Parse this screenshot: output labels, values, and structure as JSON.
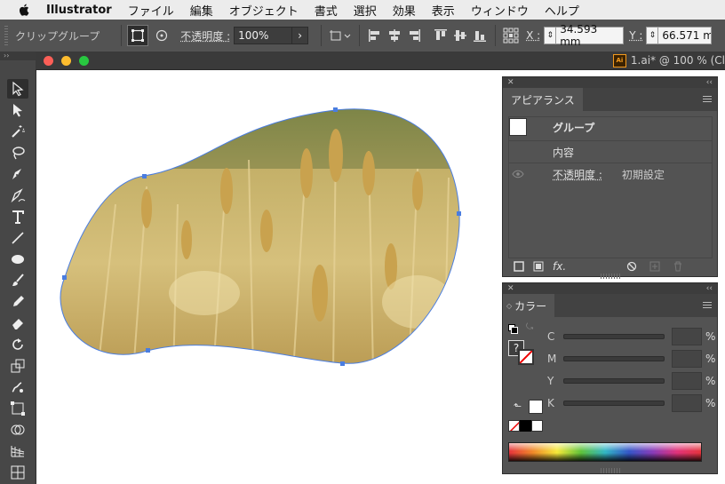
{
  "menubar": {
    "app_name": "Illustrator",
    "items": [
      "ファイル",
      "編集",
      "オブジェクト",
      "書式",
      "選択",
      "効果",
      "表示",
      "ウィンドウ",
      "ヘルプ"
    ]
  },
  "control_bar": {
    "selection_label": "クリップグループ",
    "opacity_label": "不透明度 :",
    "opacity_value": "100%",
    "x_label": "X :",
    "x_value": "34.593 mm",
    "y_label": "Y :",
    "y_value": "66.571 m"
  },
  "document": {
    "title": "1.ai* @ 100 % (Cl"
  },
  "appearance_panel": {
    "tab": "アピアランス",
    "group_label": "グループ",
    "contents_label": "内容",
    "opacity_label": "不透明度 :",
    "opacity_value": "初期設定",
    "fx_label": "fx."
  },
  "color_panel": {
    "tab": "カラー",
    "channels": [
      "C",
      "M",
      "Y",
      "K"
    ],
    "percent": "%",
    "unknown_mark": "?"
  },
  "colors": {
    "selection_blue": "#4a7de0",
    "ui_dark": "#535353",
    "canvas": "#ffffff"
  },
  "icons": {
    "toolbar": [
      "selection-tool-icon",
      "direct-selection-tool-icon",
      "magic-wand-tool-icon",
      "lasso-tool-icon",
      "pen-tool-icon",
      "curvature-tool-icon",
      "type-tool-icon",
      "line-tool-icon",
      "ellipse-tool-icon",
      "paintbrush-tool-icon",
      "pencil-tool-icon",
      "eraser-tool-icon",
      "rotate-tool-icon",
      "scale-tool-icon",
      "warp-tool-icon",
      "free-transform-tool-icon",
      "shape-builder-tool-icon",
      "perspective-grid-tool-icon",
      "mesh-tool-icon"
    ]
  }
}
